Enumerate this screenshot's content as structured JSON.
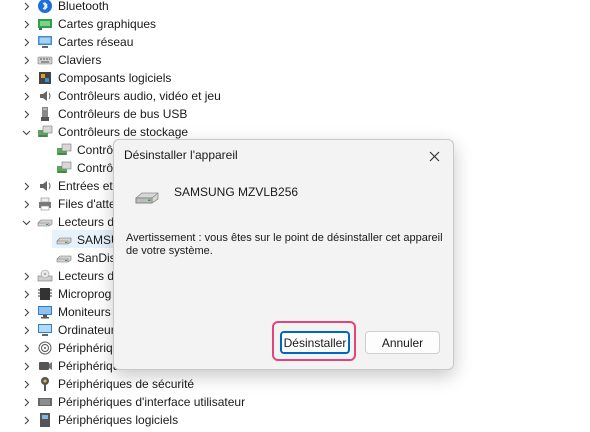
{
  "tree": {
    "items": [
      {
        "label": "Bluetooth",
        "icon": "bluetooth-icon",
        "state": "collapsed"
      },
      {
        "label": "Cartes graphiques",
        "icon": "display-adapter-icon",
        "state": "collapsed"
      },
      {
        "label": "Cartes réseau",
        "icon": "network-adapter-icon",
        "state": "collapsed"
      },
      {
        "label": "Claviers",
        "icon": "keyboard-icon",
        "state": "collapsed"
      },
      {
        "label": "Composants logiciels",
        "icon": "software-component-icon",
        "state": "collapsed"
      },
      {
        "label": "Contrôleurs audio, vidéo et jeu",
        "icon": "speaker-icon",
        "state": "collapsed"
      },
      {
        "label": "Contrôleurs de bus USB",
        "icon": "usb-icon",
        "state": "collapsed"
      },
      {
        "label": "Contrôleurs de stockage",
        "icon": "storage-controller-icon",
        "state": "expanded"
      },
      {
        "label": "Contrô",
        "icon": "storage-controller-icon",
        "state": "child"
      },
      {
        "label": "Contrô",
        "icon": "storage-controller-icon",
        "state": "child"
      },
      {
        "label": "Entrées et s",
        "icon": "speaker-icon",
        "state": "collapsed"
      },
      {
        "label": "Files d'atte",
        "icon": "printer-queue-icon",
        "state": "collapsed"
      },
      {
        "label": "Lecteurs d",
        "icon": "disk-drive-icon",
        "state": "expanded"
      },
      {
        "label": "SAMSU",
        "icon": "disk-drive-icon",
        "state": "child"
      },
      {
        "label": "SanDisl",
        "icon": "disk-drive-icon",
        "state": "child"
      },
      {
        "label": "Lecteurs d",
        "icon": "dvd-drive-icon",
        "state": "collapsed"
      },
      {
        "label": "Microprog",
        "icon": "firmware-icon",
        "state": "collapsed"
      },
      {
        "label": "Moniteurs",
        "icon": "monitor-icon",
        "state": "collapsed"
      },
      {
        "label": "Ordinateur",
        "icon": "computer-icon",
        "state": "collapsed"
      },
      {
        "label": "Périphériqu",
        "icon": "biometric-icon",
        "state": "collapsed"
      },
      {
        "label": "Périphériques de caméra de bureau à distance",
        "icon": "camera-icon",
        "state": "collapsed"
      },
      {
        "label": "Périphériques de sécurité",
        "icon": "security-key-icon",
        "state": "collapsed"
      },
      {
        "label": "Périphériques d'interface utilisateur",
        "icon": "hid-icon",
        "state": "collapsed"
      },
      {
        "label": "Périphériques logiciels",
        "icon": "software-device-icon",
        "state": "collapsed"
      }
    ]
  },
  "dialog": {
    "title": "Désinstaller l'appareil",
    "device_name": "SAMSUNG MZVLB256",
    "warning": "Avertissement : vous êtes sur le point de désinstaller cet appareil de votre système.",
    "uninstall_label": "Désinstaller",
    "cancel_label": "Annuler"
  },
  "colors": {
    "accent": "#0067c0",
    "highlight": "#e0457b",
    "selection": "#e5f1fb"
  }
}
